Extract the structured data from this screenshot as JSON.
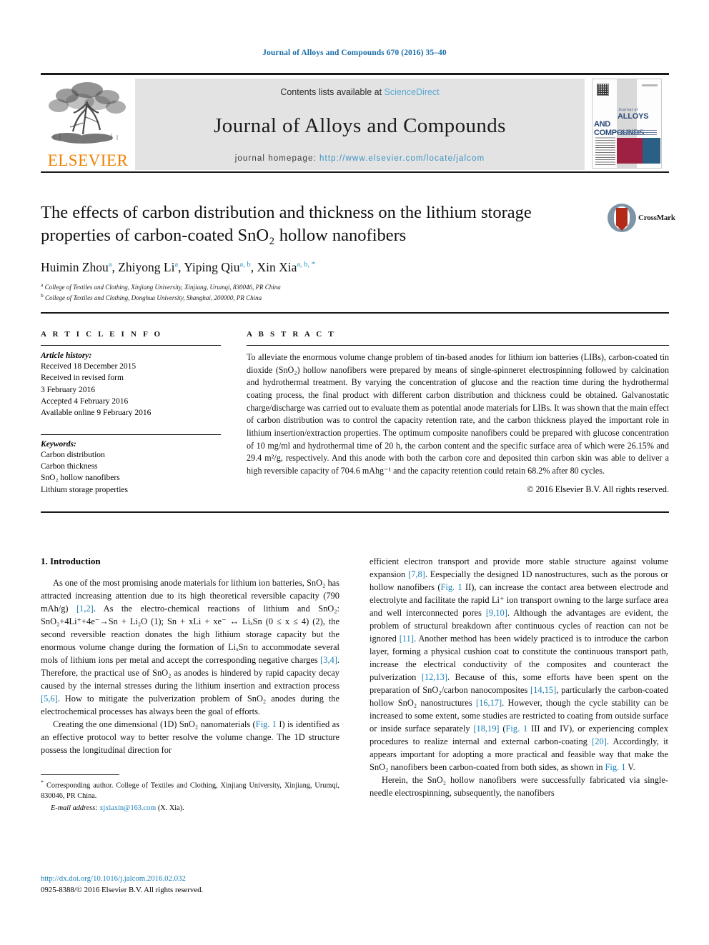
{
  "running_head": "Journal of Alloys and Compounds 670 (2016) 35–40",
  "masthead": {
    "contents_prefix": "Contents lists available at ",
    "sciencedirect": "ScienceDirect",
    "journal_title": "Journal of Alloys and Compounds",
    "homepage_label": "journal homepage: ",
    "homepage_url": "http://www.elsevier.com/locate/jalcom",
    "publisher": "ELSEVIER",
    "cover": {
      "journal_of": "Journal of",
      "alloys": "ALLOYS",
      "and_compounds": "AND COMPOUNDS"
    }
  },
  "article": {
    "title": "The effects of carbon distribution and thickness on the lithium storage properties of carbon-coated SnO₂ hollow nanofibers",
    "crossmark_label": "CrossMark",
    "authors": [
      {
        "name": "Huimin Zhou",
        "marks": "a"
      },
      {
        "name": "Zhiyong Li",
        "marks": "a"
      },
      {
        "name": "Yiping Qiu",
        "marks": "a, b"
      },
      {
        "name": "Xin Xia",
        "marks": "a, b, *"
      }
    ],
    "affiliations": [
      {
        "mark": "a",
        "text": "College of Textiles and Clothing, Xinjiang University, Xinjiang, Urumqi, 830046, PR China"
      },
      {
        "mark": "b",
        "text": "College of Textiles and Clothing, Donghua University, Shanghai, 200000, PR China"
      }
    ]
  },
  "article_info": {
    "heading": "A R T I C L E  I N F O",
    "history_label": "Article history:",
    "history": [
      "Received 18 December 2015",
      "Received in revised form",
      "3 February 2016",
      "Accepted 4 February 2016",
      "Available online 9 February 2016"
    ],
    "keywords_label": "Keywords:",
    "keywords": [
      "Carbon distribution",
      "Carbon thickness",
      "SnO₂ hollow nanofibers",
      "Lithium storage properties"
    ]
  },
  "abstract": {
    "heading": "A B S T R A C T",
    "text": "To alleviate the enormous volume change problem of tin-based anodes for lithium ion batteries (LIBs), carbon-coated tin dioxide (SnO₂) hollow nanofibers were prepared by means of single-spinneret electrospinning followed by calcination and hydrothermal treatment. By varying the concentration of glucose and the reaction time during the hydrothermal coating process, the final product with different carbon distribution and thickness could be obtained. Galvanostatic charge/discharge was carried out to evaluate them as potential anode materials for LIBs. It was shown that the main effect of carbon distribution was to control the capacity retention rate, and the carbon thickness played the important role in lithium insertion/extraction properties. The optimum composite nanofibers could be prepared with glucose concentration of 10 mg/ml and hydrothermal time of 20 h, the carbon content and the specific surface area of which were 26.15% and 29.4 m²/g, respectively. And this anode with both the carbon core and deposited thin carbon skin was able to deliver a high reversible capacity of 704.6 mAhg⁻¹ and the capacity retention could retain 68.2% after 80 cycles.",
    "copyright": "© 2016 Elsevier B.V. All rights reserved."
  },
  "introduction": {
    "section_number_title": "1.  Introduction",
    "left_para1_a": "As one of the most promising anode materials for lithium ion batteries, SnO₂ has attracted increasing attention due to its high theoretical reversible capacity (790 mAh/g) ",
    "left_para1_ref1": "[1,2]",
    "left_para1_b": ". As the electro-chemical reactions of lithium and SnO₂: SnO₂+4Li⁺+4e⁻→Sn + Li₂O (1); Sn + xLi + xe⁻ ↔ Li",
    "left_para1_eq": "ₓSn (0 ≤ x ≤ 4)",
    "left_para1_c": " (2), the second reversible reaction donates the high lithium storage capacity but the enormous volume change during the formation of LiₓSn to accommodate several mols of lithium ions per metal and accept the corresponding negative charges ",
    "left_para1_ref2": "[3,4]",
    "left_para1_d": ". Therefore, the practical use of SnO₂ as anodes is hindered by rapid capacity decay caused by the internal stresses during the lithium insertion and extraction process ",
    "left_para1_ref3": "[5,6]",
    "left_para1_e": ". How to mitigate the pulverization problem of SnO₂ anodes during the electrochemical processes has always been the goal of efforts.",
    "left_para2_a": "Creating the one dimensional (1D) SnO₂ nanomaterials (",
    "left_para2_fig": "Fig. 1",
    "left_para2_b": " I) is identified as an effective protocol way to better resolve the volume change. The 1D structure possess the longitudinal direction for",
    "right_para1_a": "efficient electron transport and provide more stable structure against volume expansion ",
    "right_para1_ref1": "[7,8]",
    "right_para1_b": ". Eespecially the designed 1D nanostructures, such as the porous or hollow nanofibers (",
    "right_para1_fig1": "Fig. 1",
    "right_para1_c": " II), can increase the contact area between electrode and electrolyte and facilitate the rapid Li⁺ ion transport owning to the large surface area and well interconnected pores ",
    "right_para1_ref2": "[9,10]",
    "right_para1_d": ". Although the advantages are evident, the problem of structural breakdown after continuous cycles of reaction can not be ignored ",
    "right_para1_ref3": "[11]",
    "right_para1_e": ". Another method has been widely practiced is to introduce the carbon layer, forming a physical cushion coat to constitute the continuous transport path, increase the electrical conductivity of the composites and counteract the pulverization ",
    "right_para1_ref4": "[12,13]",
    "right_para1_f": ". Because of this, some efforts have been spent on the preparation of SnO₂/carbon nanocomposites ",
    "right_para1_ref5": "[14,15]",
    "right_para1_g": ", particularly the carbon-coated hollow SnO₂ nanostructures ",
    "right_para1_ref6": "[16,17]",
    "right_para1_h": ". However, though the cycle stability can be increased to some extent, some studies are restricted to coating from outside surface or inside surface separately ",
    "right_para1_ref7": "[18,19]",
    "right_para1_i": " (",
    "right_para1_fig2": "Fig. 1",
    "right_para1_j": " III and IV), or experiencing complex procedures to realize internal and external carbon-coating ",
    "right_para1_ref8": "[20]",
    "right_para1_k": ". Accordingly, it appears important for adopting a more practical and feasible way that make the SnO₂ nanofibers been carbon-coated from both sides, as shown in ",
    "right_para1_fig3": "Fig. 1",
    "right_para1_l": " V.",
    "right_para2": "Herein, the SnO₂ hollow nanofibers were successfully fabricated via single-needle electrospinning, subsequently, the nanofibers"
  },
  "footnote": {
    "star": "*",
    "text": " Corresponding author. College of Textiles and Clothing, Xinjiang University, Xinjiang, Urumqi, 830046, PR China.",
    "email_label": "E-mail address: ",
    "email": "xjxiaxin@163.com",
    "email_suffix": " (X. Xia)."
  },
  "bottom": {
    "doi": "http://dx.doi.org/10.1016/j.jalcom.2016.02.032",
    "issn_line": "0925-8388/© 2016 Elsevier B.V. All rights reserved."
  },
  "colors": {
    "link_blue": "#1a7fb5",
    "header_blue": "#1a6ea8",
    "elsevier_orange": "#ef8200",
    "sciencedirect_blue": "#5aa9d6"
  }
}
